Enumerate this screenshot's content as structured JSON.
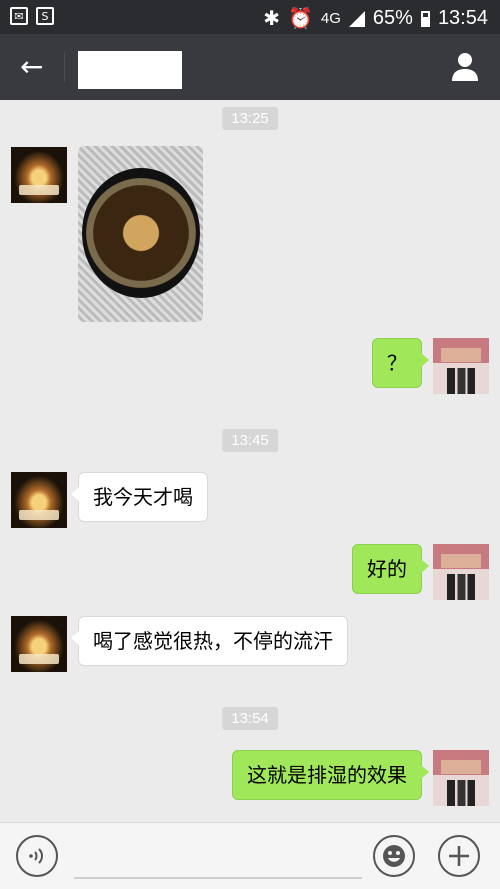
{
  "status_bar": {
    "mail_icon": "mail-icon",
    "s_icon": "s-app-icon",
    "bluetooth_icon": "bluetooth-icon",
    "alarm_icon": "alarm-icon",
    "network": "4G",
    "battery": "65%",
    "time": "13:54"
  },
  "header": {
    "back_icon": "back-arrow-icon",
    "title": "",
    "profile_icon": "profile-icon"
  },
  "chat": {
    "times": [
      "13:25",
      "13:45",
      "13:54"
    ],
    "messages": [
      {
        "side": "left",
        "type": "image",
        "text": ""
      },
      {
        "side": "right",
        "type": "text",
        "text": "？"
      },
      {
        "side": "left",
        "type": "text",
        "text": "我今天才喝"
      },
      {
        "side": "right",
        "type": "text",
        "text": "好的"
      },
      {
        "side": "left",
        "type": "text",
        "text": "喝了感觉很热，不停的流汗"
      },
      {
        "side": "right",
        "type": "text",
        "text": "这就是排湿的效果"
      }
    ]
  },
  "input_bar": {
    "voice_icon": "voice-icon",
    "emoji_icon": "emoji-icon",
    "add_icon": "add-icon"
  }
}
